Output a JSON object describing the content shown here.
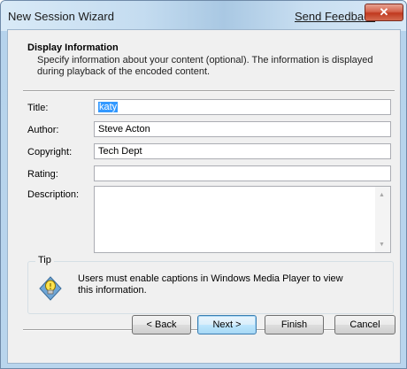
{
  "window": {
    "title": "New Session Wizard",
    "feedback_link": "Send Feedback",
    "close_glyph": "✕"
  },
  "header": {
    "title": "Display Information",
    "description": "Specify information about your content (optional). The information is displayed during playback of the encoded content."
  },
  "form": {
    "title_label": "Title:",
    "title_value": "katy",
    "author_label": "Author:",
    "author_value": "Steve Acton",
    "copyright_label": "Copyright:",
    "copyright_value": "Tech Dept",
    "rating_label": "Rating:",
    "rating_value": "",
    "description_label": "Description:",
    "description_value": ""
  },
  "tip": {
    "legend": "Tip",
    "icon": "lightbulb-icon",
    "text": "Users must enable captions in Windows Media Player to view this information."
  },
  "buttons": {
    "back": "< Back",
    "next": "Next >",
    "finish": "Finish",
    "cancel": "Cancel"
  },
  "colors": {
    "accent": "#3399ff",
    "close": "#c0391f"
  }
}
